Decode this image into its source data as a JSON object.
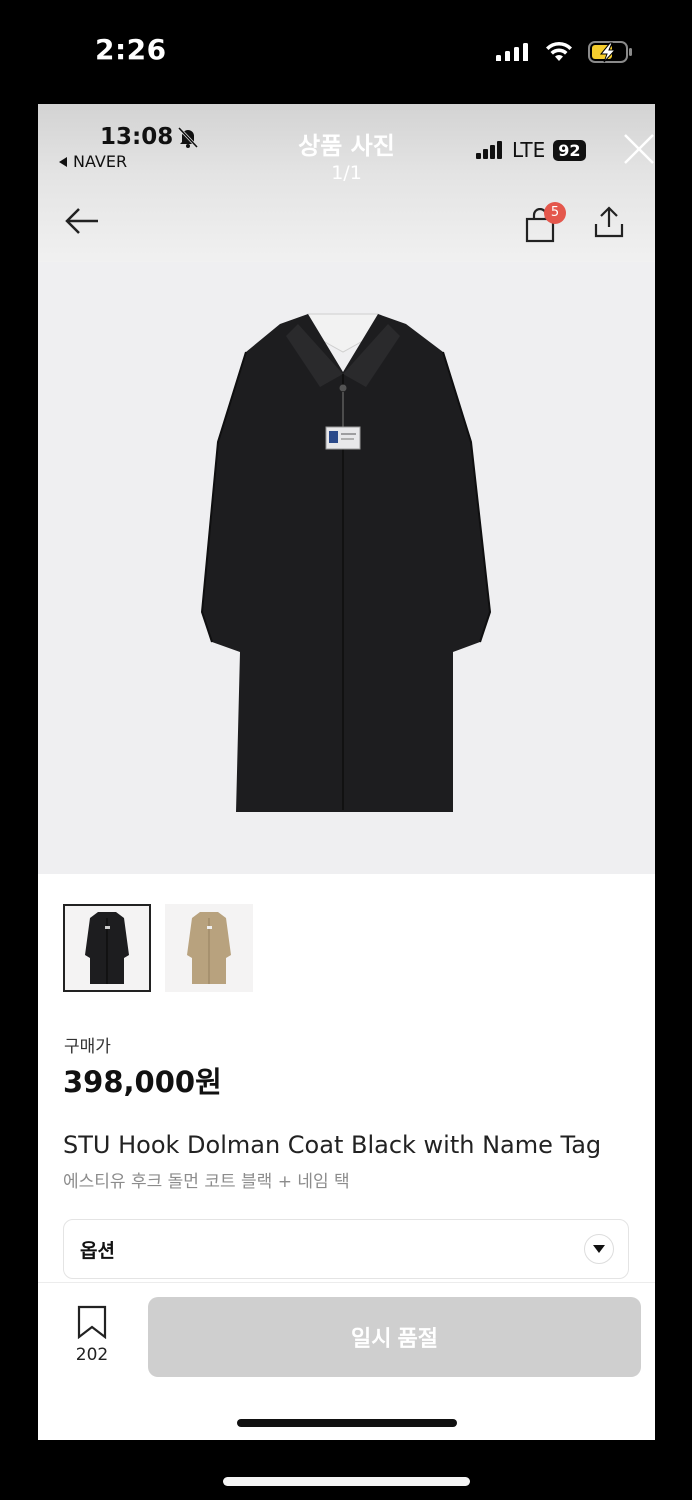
{
  "device": {
    "time": "2:26"
  },
  "inner_device": {
    "time": "13:08",
    "back_app": "NAVER",
    "network": "LTE",
    "battery": "92"
  },
  "viewer": {
    "title": "상품 사진",
    "counter": "1/1"
  },
  "header": {
    "cart_count": "5"
  },
  "product": {
    "price_label": "구매가",
    "price": "398,000원",
    "name_en": "STU Hook Dolman Coat Black with Name Tag",
    "name_ko": "에스티유 후크 돌먼 코트 블랙 + 네임 택",
    "thumbnails": [
      "black",
      "beige"
    ],
    "option_label": "옵션"
  },
  "footer": {
    "wish_count": "202",
    "soldout_label": "일시 품절"
  },
  "colors": {
    "coat_black": "#1d1d1f",
    "coat_beige": "#b8a27e",
    "badge_red": "#e4574c",
    "disabled_button": "#cfcfcf"
  },
  "icons": [
    "signal-icon",
    "wifi-icon",
    "battery-charging-icon",
    "bell-slash-icon",
    "close-icon",
    "back-arrow-icon",
    "shopping-bag-icon",
    "share-icon",
    "chevron-down-icon",
    "bookmark-icon"
  ]
}
